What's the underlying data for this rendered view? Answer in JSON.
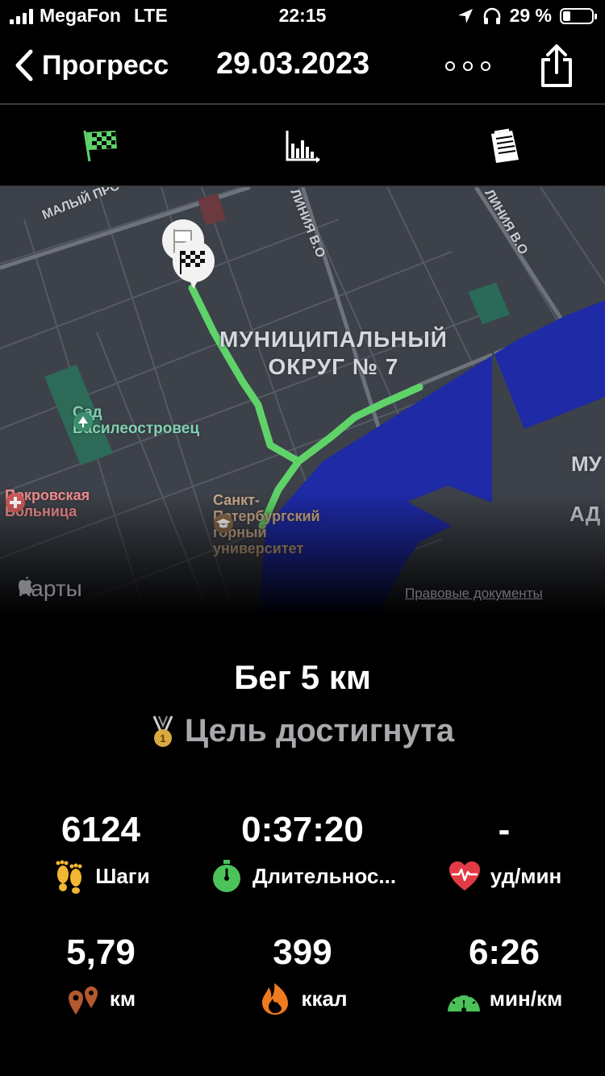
{
  "status": {
    "carrier": "MegaFon",
    "network": "LTE",
    "time": "22:15",
    "battery": "29 %"
  },
  "nav": {
    "back_label": "Прогресс",
    "date": "29.03.2023"
  },
  "map": {
    "district_line1": "МУНИЦИПАЛЬНЫЙ",
    "district_line2": "ОКРУГ № 7",
    "street1": "МАЛЫЙ ПРОС",
    "street2": "ЛИНИЯ В.О",
    "street3": "ЛИНИЯ В.О",
    "park": "Сад\nВасилеостровец",
    "hospital": "Покровская\nБольница",
    "university": "Санкт-\nПетербургский\nгорный\nуниверситет",
    "edge1": "МУ",
    "edge2": "АД",
    "attribution": "Карты",
    "legal": "Правовые документы",
    "route_color": "#5fd36a",
    "water_color": "#1e2aa6"
  },
  "workout": {
    "title": "Бег 5 км",
    "goal": "Цель достигнута"
  },
  "stats": {
    "steps": {
      "value": "6124",
      "unit": "Шаги"
    },
    "duration": {
      "value": "0:37:20",
      "unit": "Длительнос..."
    },
    "heart": {
      "value": "-",
      "unit": "уд/мин"
    },
    "distance": {
      "value": "5,79",
      "unit": "км"
    },
    "calories": {
      "value": "399",
      "unit": "ккал"
    },
    "pace": {
      "value": "6:26",
      "unit": "мин/км"
    }
  },
  "icons": {
    "tab1": "checkered-flag-icon",
    "tab2": "bar-chart-icon",
    "tab3": "receipt-icon",
    "steps": "footprints-icon",
    "duration": "stopwatch-icon",
    "heart": "heart-pulse-icon",
    "distance": "location-pins-icon",
    "calories": "flame-icon",
    "pace": "speedometer-icon"
  }
}
